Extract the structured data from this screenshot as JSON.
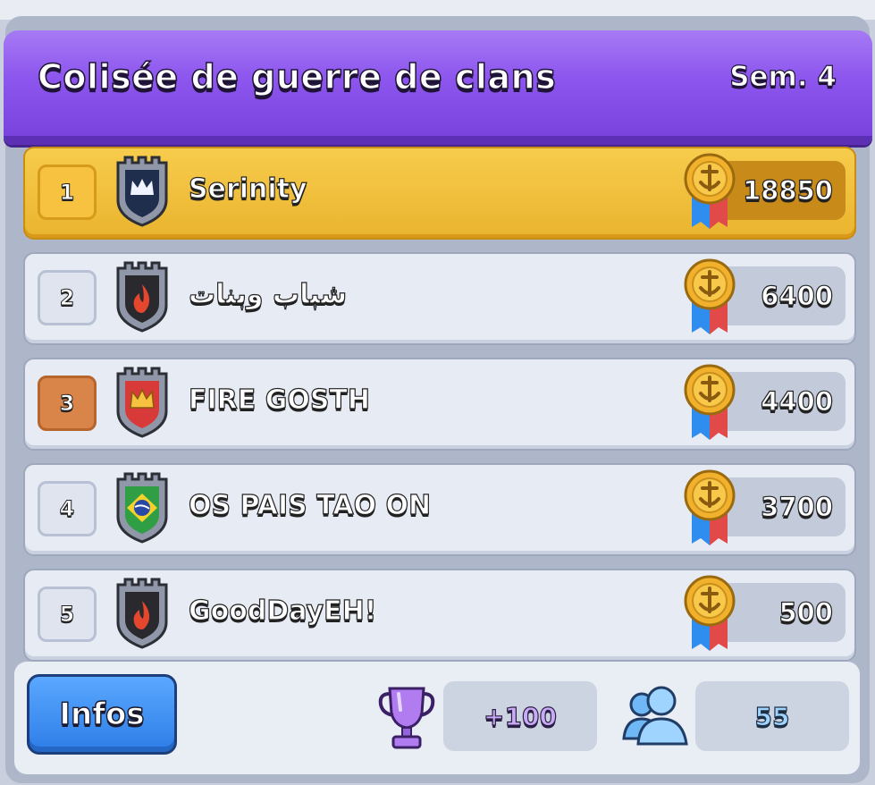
{
  "header": {
    "title": "Colisée de guerre de clans",
    "week": "Sem. 4"
  },
  "rows": [
    {
      "rank": "1",
      "name": "Serinity",
      "score": "18850",
      "badge": "crown-badge"
    },
    {
      "rank": "2",
      "name": "شباب وبنات",
      "score": "6400",
      "badge": "flame-badge"
    },
    {
      "rank": "3",
      "name": "FIRE GOSTH",
      "score": "4400",
      "badge": "crown-badge"
    },
    {
      "rank": "4",
      "name": "OS PAIS TAO ON",
      "score": "3700",
      "badge": "brazil-flag-badge"
    },
    {
      "rank": "5",
      "name": "GoodDayEH!",
      "score": "500",
      "badge": "flame-badge"
    }
  ],
  "footer": {
    "info_label": "Infos",
    "trophy_value": "+100",
    "members_value": "55"
  },
  "colors": {
    "banner": "#8d56ee",
    "first_place": "#f6c23f",
    "third_place": "#d98448",
    "info_button": "#2d7de8"
  }
}
